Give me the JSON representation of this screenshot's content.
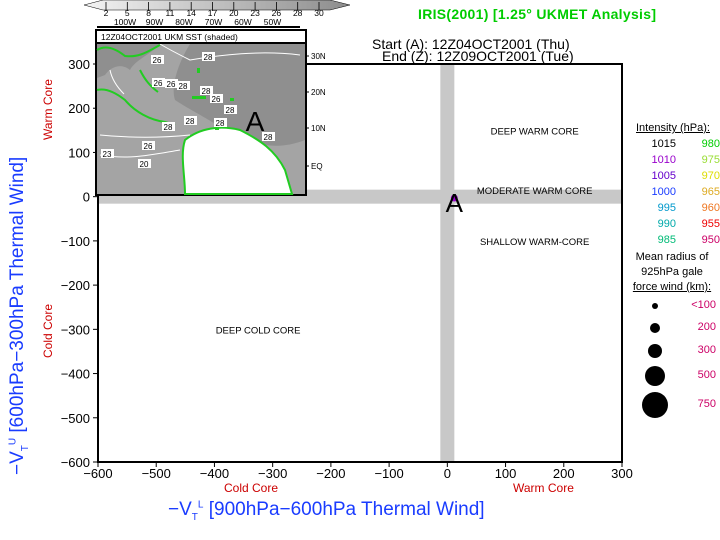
{
  "title": "IRIS(2001) [1.25° UKMET Analysis]",
  "start_label": "Start (A): 12Z04OCT2001 (Thu)",
  "end_label": "End (Z): 12Z09OCT2001 (Tue)",
  "colorbar": {
    "ticks": [
      "2",
      "5",
      "8",
      "11",
      "14",
      "17",
      "20",
      "23",
      "26",
      "28",
      "30"
    ],
    "lon_labels": [
      "100W",
      "90W",
      "80W",
      "70W",
      "60W",
      "50W"
    ]
  },
  "inset": {
    "title": "12Z04OCT2001 UKM SST (shaded)",
    "lat_labels": [
      "30N",
      "20N",
      "10N",
      "EQ"
    ],
    "contour_labels": [
      "26",
      "28",
      "26",
      "26",
      "28",
      "28",
      "26",
      "28",
      "28",
      "28",
      "28",
      "26",
      "23",
      "20",
      "28"
    ],
    "marker": "A"
  },
  "chart_data": {
    "type": "scatter",
    "title": "IRIS(2001) [1.25° UKMET Analysis]",
    "xlabel": "−VT^L [900hPa−600hPa Thermal Wind]",
    "ylabel": "−VT^U [600hPa−300hPa Thermal Wind]",
    "xlim": [
      -600,
      300
    ],
    "ylim": [
      -600,
      300
    ],
    "x_ticks": [
      "-600",
      "-500",
      "-400",
      "-300",
      "-200",
      "-100",
      "0",
      "100",
      "200",
      "300"
    ],
    "y_ticks": [
      "300",
      "200",
      "100",
      "0",
      "-100",
      "-200",
      "-300",
      "-400",
      "-500",
      "-600"
    ],
    "x_tick_values": [
      -600,
      -500,
      -400,
      -300,
      -200,
      -100,
      0,
      100,
      200,
      300
    ],
    "y_tick_values": [
      300,
      200,
      100,
      0,
      -100,
      -200,
      -300,
      -400,
      -500,
      -600
    ],
    "x_side_labels": {
      "cold": "Cold Core",
      "warm": "Warm Core"
    },
    "y_side_labels": {
      "cold": "Cold Core",
      "warm": "Warm Core"
    },
    "region_labels": [
      {
        "text": "DEEP WARM CORE",
        "x": 150,
        "y": 150
      },
      {
        "text": "MODERATE WARM CORE",
        "x": 150,
        "y": 15
      },
      {
        "text": "SHALLOW WARM-CORE",
        "x": 150,
        "y": -100
      },
      {
        "text": "DEEP COLD CORE",
        "x": -325,
        "y": -300
      }
    ],
    "points": [
      {
        "label": "A",
        "x": 12,
        "y": -3,
        "intensity_hPa": 1010,
        "color": "#9900cc",
        "gale_radius_km": "<100"
      }
    ],
    "legend_intensity": {
      "title": "Intensity (hPa):",
      "entries": [
        {
          "value": "1015",
          "color": "#000000"
        },
        {
          "value": "980",
          "color": "#00cc00"
        },
        {
          "value": "1010",
          "color": "#9900cc"
        },
        {
          "value": "975",
          "color": "#99dd33"
        },
        {
          "value": "1005",
          "color": "#6600cc"
        },
        {
          "value": "970",
          "color": "#dddd00"
        },
        {
          "value": "1000",
          "color": "#1a3cff"
        },
        {
          "value": "965",
          "color": "#ddaa22"
        },
        {
          "value": "995",
          "color": "#0099cc"
        },
        {
          "value": "960",
          "color": "#ee7722"
        },
        {
          "value": "990",
          "color": "#00aaaa"
        },
        {
          "value": "955",
          "color": "#ee0000"
        },
        {
          "value": "985",
          "color": "#00bb77"
        },
        {
          "value": "950",
          "color": "#cc0066"
        }
      ]
    },
    "legend_radius": {
      "title_lines": [
        "Mean radius of",
        "925hPa gale",
        "force wind (km):"
      ],
      "entries": [
        "<100",
        "200",
        "300",
        "500",
        "750"
      ],
      "label_color": "#cc0066"
    },
    "grid": false,
    "legend_placement": "right"
  }
}
